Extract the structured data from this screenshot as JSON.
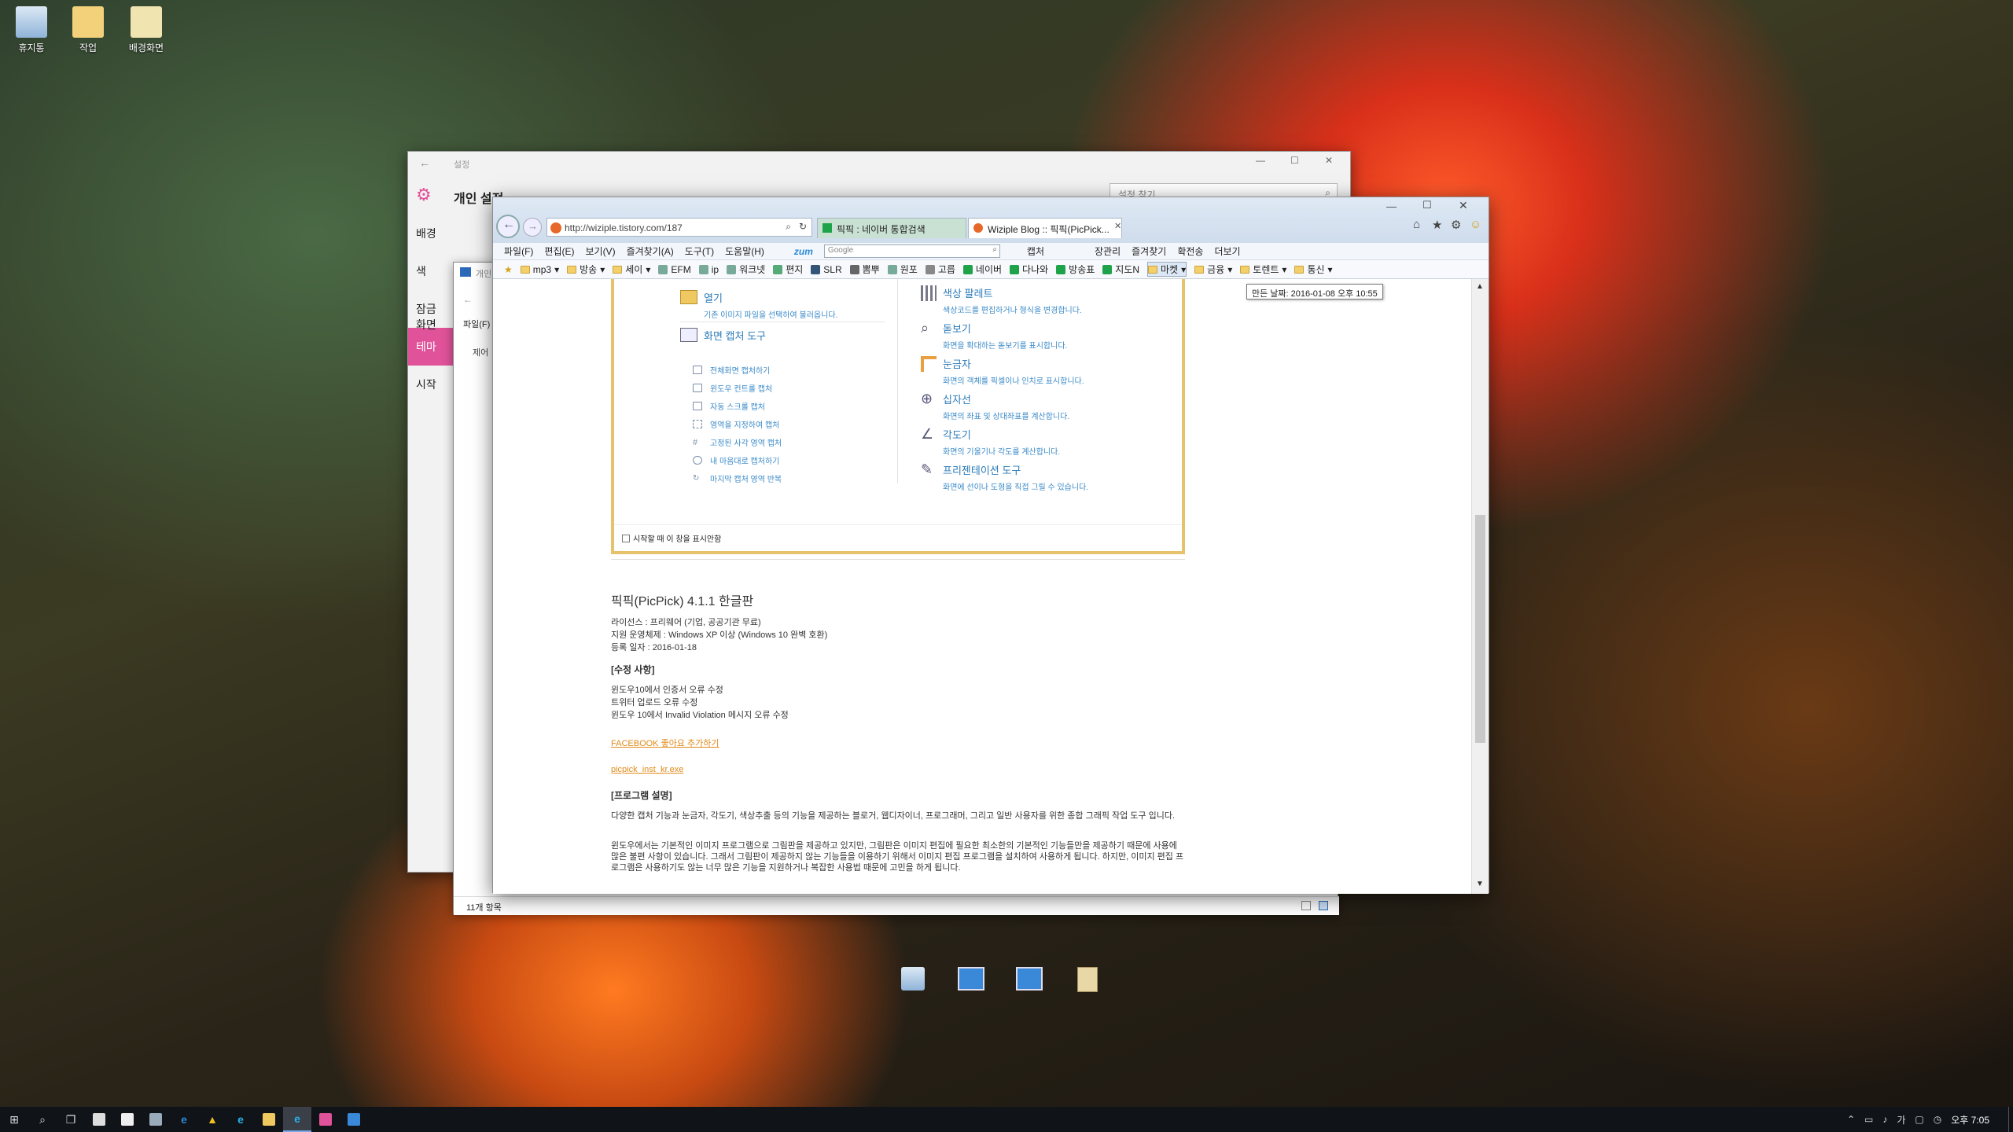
{
  "desktop": {
    "icons": [
      {
        "label": "휴지통",
        "color": "#9ec4e8"
      },
      {
        "label": "작업",
        "color": "#f3d07a"
      },
      {
        "label": "배경화면",
        "color": "#f0e4b0"
      }
    ]
  },
  "settings": {
    "back_label": "←",
    "title_small": "설정",
    "header": "개인 설정",
    "search_placeholder": "설정 찾기",
    "nav": [
      "배경",
      "색",
      "잠금 화면",
      "테마",
      "시작"
    ],
    "active_index": 3
  },
  "explorer": {
    "title": "개인",
    "menu": "파일(F)",
    "row_label": "제어",
    "status": "11개 항목"
  },
  "ie": {
    "url": "http://wiziple.tistory.com/187",
    "tabs": [
      {
        "label": "픽픽 : 네이버 통합검색"
      },
      {
        "label": "Wiziple Blog :: 픽픽(PicPick..."
      }
    ],
    "menu": [
      "파일(F)",
      "편집(E)",
      "보기(V)",
      "즐겨찾기(A)",
      "도구(T)",
      "도움말(H)"
    ],
    "zum_label": "zum",
    "google_placeholder": "Google",
    "toolbar_right": [
      "캡처",
      "장관리",
      "즐겨찾기",
      "확전송",
      "더보기"
    ],
    "favorites": [
      "mp3",
      "방송",
      "세이",
      "EFM",
      "ip",
      "워크넷",
      "편지",
      "SLR",
      "뽐뿌",
      "원포",
      "고릅",
      "네이버",
      "다나와",
      "방송표",
      "지도N",
      "마켓",
      "금융",
      "토렌트",
      "통신"
    ],
    "tooltip": "만든 날짜: 2016-01-08 오후 10:55",
    "panel": {
      "left": [
        {
          "title": "열기",
          "desc": "기존 이미지 파일을 선택하여 불러옵니다."
        },
        {
          "title": "화면 캡처 도구",
          "desc": ""
        }
      ],
      "subs": [
        "전체화면 캡처하기",
        "윈도우 컨트롤 캡처",
        "자동 스크롤 캡처",
        "영역을 지정하여 캡처",
        "고정된 사각 영역 캡처",
        "내 마음대로 캡처하기",
        "마지막 캡처 영역 반복"
      ],
      "right": [
        {
          "title": "색상 팔레트",
          "desc": "색상코드를 편집하거나 형식을 변경합니다."
        },
        {
          "title": "돋보기",
          "desc": "화면을 확대하는 돋보기를 표시합니다."
        },
        {
          "title": "눈금자",
          "desc": "화면의 객체를 픽셀이나 인치로 표시합니다."
        },
        {
          "title": "십자선",
          "desc": "화면의 좌표 및 상대좌표를 계산합니다."
        },
        {
          "title": "각도기",
          "desc": "화면의 기울기나 각도를 계산합니다."
        },
        {
          "title": "프리젠테이션 도구",
          "desc": "화면에 선이나 도형을 직접 그릴 수 있습니다."
        }
      ],
      "checkbox": "시작할 때 이 창을 표시안함"
    },
    "blog": {
      "title": "픽픽(PicPick) 4.1.1 한글판",
      "license": "라이선스 : 프리웨어 (기업, 공공기관 무료)",
      "os": "지원 운영체제 : Windows XP 이상 (Windows 10 완벽 호환)",
      "date": "등록 일자 : 2016-01-18",
      "fix_header": "[수정 사항]",
      "fixes": [
        "윈도우10에서 인증서 오류 수정",
        "트위터 업로드 오류 수정",
        "윈도우 10에서 Invalid Violation 메시지 오류 수정"
      ],
      "facebook": "FACEBOOK 좋아요 추가하기",
      "download": "picpick_inst_kr.exe",
      "desc_header": "[프로그램 설명]",
      "desc1": "다양한 캡처 기능과 눈금자, 각도기, 색상추출 등의 기능을 제공하는 블로거, 웹디자이너, 프로그래머, 그리고 일반 사용자를 위한 종합 그래픽 작업 도구 입니다.",
      "desc2": "윈도우에서는 기본적인 이미지 프로그램으로 그림판을 제공하고 있지만, 그림판은 이미지 편집에 필요한 최소한의 기본적인 기능들만을 제공하기 때문에 사용에 많은 불편 사항이 있습니다. 그래서 그림판이 제공하지 않는 기능들을 이용하기 위해서 이미지 편집 프로그램을 설치하여 사용하게 됩니다. 하지만, 이미지 편집 프로그램은 사용하기도 않는 너무 많은 기능을 지원하거나 복잡한 사용법 때문에 고민을 하게 됩니다."
    }
  },
  "taskbar": {
    "time": "오후 7:05"
  },
  "colors": {
    "accent": "#e0529a",
    "link": "#e08a1a",
    "panel_border": "#e6c36a"
  }
}
